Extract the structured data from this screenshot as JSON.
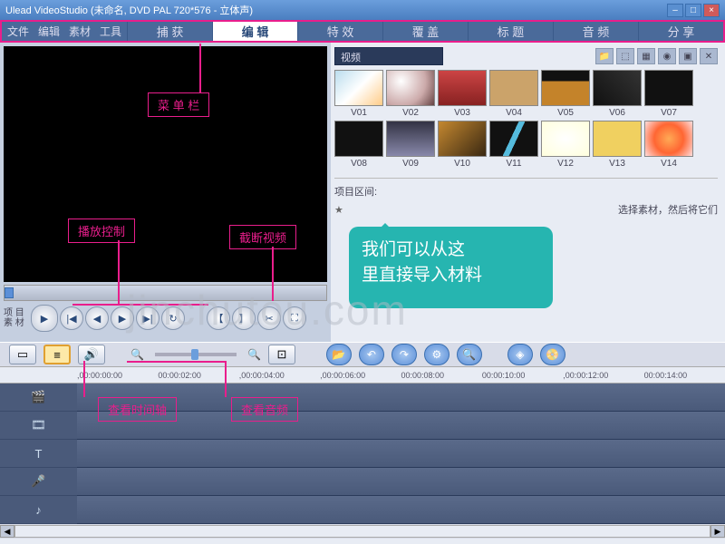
{
  "title": "Ulead VideoStudio (未命名, DVD PAL 720*576 - 立体声)",
  "menu": {
    "file": "文件",
    "edit": "编辑",
    "clip": "素材",
    "tool": "工具"
  },
  "steps": {
    "capture": "捕 获",
    "edit": "编 辑",
    "effect": "特 效",
    "overlay": "覆 盖",
    "title": "标 题",
    "audio": "音 频",
    "share": "分 享"
  },
  "project": {
    "l1": "项 目",
    "l2": "素 材"
  },
  "lib_drop": "视频",
  "thumbs": [
    "V01",
    "V02",
    "V03",
    "V04",
    "V05",
    "V06",
    "V07",
    "V08",
    "V09",
    "V10",
    "V11",
    "V12",
    "V13",
    "V14"
  ],
  "opts": {
    "section": "项目区间:",
    "hint": "选择素材，然后将它们"
  },
  "ruler": [
    ",00:00:00:00",
    "00:00:02:00",
    ",00:00:04:00",
    ",00:00:06:00",
    "00:00:08:00",
    "00:00:10:00",
    ",00:00:12:00",
    "00:00:14:00"
  ],
  "call": {
    "menubar": "菜 单 栏",
    "play": "播放控制",
    "cut": "截断视频",
    "timeline": "查看时间轴",
    "audio": "查看音频"
  },
  "speech": {
    "l1": "我们可以从这",
    "l2": "里直接导入材料"
  },
  "watermark": "jinchutou.com",
  "tracks": [
    "🎬",
    "🎞",
    "T",
    "🎤",
    "♪"
  ]
}
